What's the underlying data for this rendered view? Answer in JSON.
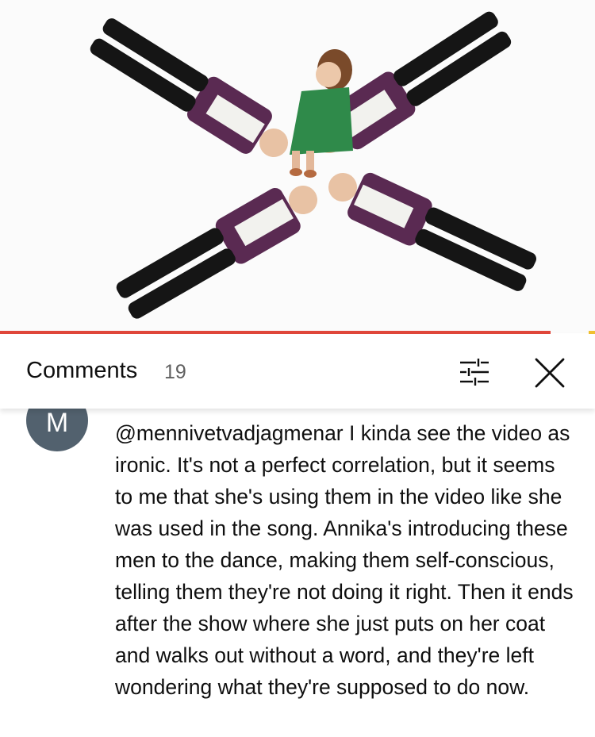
{
  "video": {
    "progress_fraction": 0.925
  },
  "comments_panel": {
    "title": "Comments",
    "count": "19",
    "filter_icon": "sliders-icon",
    "close_icon": "close-icon"
  },
  "comment": {
    "avatar_letter": "M",
    "text": "@mennivetvadjagmenar I kinda see the video as ironic. It's not a perfect correlation, but it seems to me that she's using them in the video like she was used in the song. Annika's introducing these men to the dance, making them self-conscious, telling them they're not doing it right. Then it ends after the show where she just puts on her coat and walks out without a word, and they're left wondering what they're supposed to do now."
  },
  "colors": {
    "progress": "#e0473a",
    "avatar": "#52616e",
    "jacket": "#5a2a52",
    "dress": "#2f8a4a"
  }
}
